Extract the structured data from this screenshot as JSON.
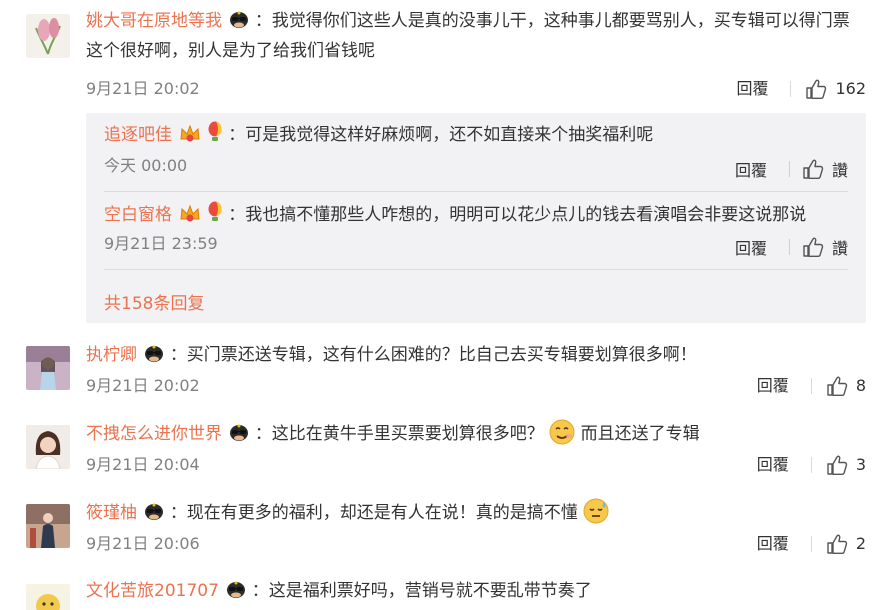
{
  "comments": [
    {
      "username": "姚大哥在原地等我",
      "text": "：我觉得你们这些人是真的没事儿干，这种事儿都要骂别人，买专辑可以得门票这个很好啊，别人是为了给我们省钱呢",
      "time": "9月21日 20:02",
      "reply_label": "回覆",
      "likes": "162",
      "replies": [
        {
          "username": "追逐吧佳",
          "text": "：可是我觉得这样好麻烦啊，还不如直接来个抽奖福利呢",
          "time": "今天 00:00",
          "reply_label": "回覆",
          "like_label": "讚"
        },
        {
          "username": "空白窗格",
          "text": "：我也搞不懂那些人咋想的，明明可以花少点儿的钱去看演唱会非要这说那说",
          "time": "9月21日 23:59",
          "reply_label": "回覆",
          "like_label": "讚"
        }
      ],
      "more_replies": "共158条回复"
    },
    {
      "username": "执柠卿",
      "text": "：买门票还送专辑，这有什么困难的？比自己去买专辑要划算很多啊！",
      "time": "9月21日 20:02",
      "reply_label": "回覆",
      "likes": "8"
    },
    {
      "username": "不拽怎么进你世界",
      "text": "：这比在黄牛手里买票要划算很多吧？",
      "text_after": "而且还送了专辑",
      "time": "9月21日 20:04",
      "reply_label": "回覆",
      "likes": "3"
    },
    {
      "username": "筱瑾柚",
      "text": "：现在有更多的福利，却还是有人在说！真的是搞不懂",
      "time": "9月21日 20:06",
      "reply_label": "回覆",
      "likes": "2"
    },
    {
      "username": "文化苦旅201707",
      "text": "：这是福利票好吗，营销号就不要乱带节奏了"
    }
  ],
  "colors": {
    "username": "#eb7350",
    "meta": "#808080",
    "reply_bg": "#f2f2f5"
  },
  "icons": [
    "vip-badge-icon",
    "crown-icon",
    "balloon-icon",
    "like-thumb-icon",
    "smirk-emoji-icon",
    "sweat-emoji-icon"
  ]
}
